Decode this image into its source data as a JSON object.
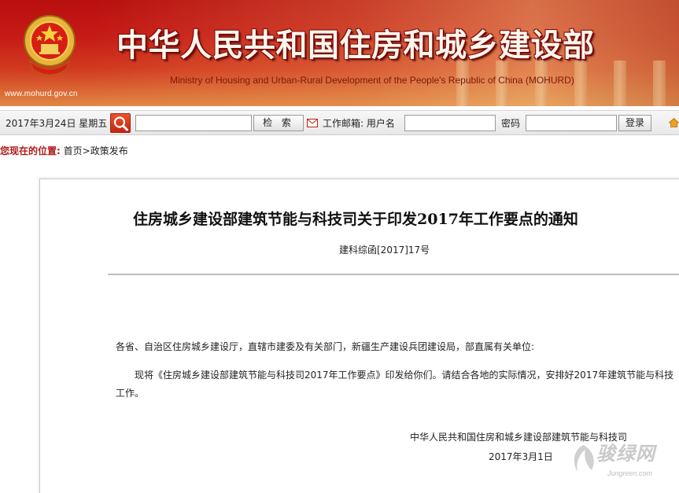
{
  "banner": {
    "title": "中华人民共和国住房和城乡建设部",
    "subtitle": "Ministry of Housing and Urban-Rural Development of the People's Republic of China (MOHURD)",
    "url": "www.mohurd.gov.cn",
    "emblem_icon": "national-emblem-icon"
  },
  "toolbar": {
    "date": "2017年3月24日  星期五",
    "search_placeholder": "",
    "search_value": "",
    "search_button": "检 索",
    "mail_label": "工作邮箱: 用户名",
    "username_value": "",
    "password_label": "密码",
    "password_value": "",
    "login_button": "登录",
    "icons": [
      "search-icon",
      "mail-icon",
      "home-icon"
    ]
  },
  "breadcrumb": {
    "label": "您现在的位置:",
    "home": "首页",
    "separator": ">",
    "current": "政策发布"
  },
  "article": {
    "title": "住房城乡建设部建筑节能与科技司关于印发2017年工作要点的通知",
    "doc_number": "建科综函[2017]17号",
    "salutation": "各省、自治区住房城乡建设厅，直辖市建委及有关部门，新疆生产建设兵团建设局，部直属有关单位:",
    "body_line1": "现将《住房城乡建设部建筑节能与科技司2017年工作要点》印发给你们。请结合各地的实际情况，安排好2017年建筑节能与科技",
    "body_line2": "工作。",
    "signature_org": "中华人民共和国住房和城乡建设部建筑节能与科技司",
    "signature_date": "2017年3月1日"
  },
  "watermark": {
    "cn": "骏绿网",
    "en": "Jungreen.com"
  },
  "colors": {
    "banner_red": "#c61b16",
    "breadcrumb_label": "#b01a1a",
    "search_button_orange": "#e9542e"
  }
}
